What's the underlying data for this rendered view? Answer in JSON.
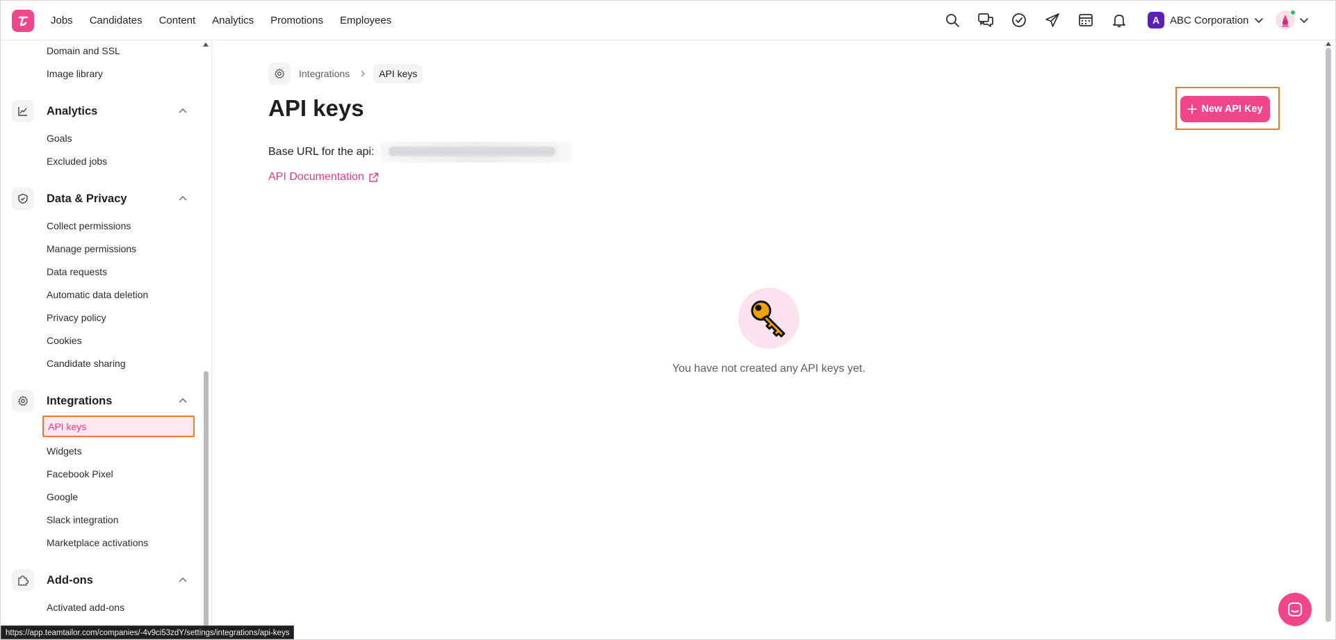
{
  "topnav": {
    "logo_letter": "T",
    "items": [
      "Jobs",
      "Candidates",
      "Content",
      "Analytics",
      "Promotions",
      "Employees"
    ],
    "company_initial": "A",
    "company_name": "ABC Corporation",
    "icons": [
      "search-icon",
      "messages-icon",
      "check-circle-icon",
      "send-icon",
      "calendar-icon",
      "bell-icon"
    ]
  },
  "sidebar": {
    "top_items": [
      "Domain and SSL",
      "Image library"
    ],
    "sections": [
      {
        "label": "Analytics",
        "icon": "chart-icon",
        "items": [
          "Goals",
          "Excluded jobs"
        ]
      },
      {
        "label": "Data & Privacy",
        "icon": "shield-icon",
        "items": [
          "Collect permissions",
          "Manage permissions",
          "Data requests",
          "Automatic data deletion",
          "Privacy policy",
          "Cookies",
          "Candidate sharing"
        ]
      },
      {
        "label": "Integrations",
        "icon": "gear-icon",
        "items": [
          "API keys",
          "Widgets",
          "Facebook Pixel",
          "Google",
          "Slack integration",
          "Marketplace activations"
        ]
      },
      {
        "label": "Add-ons",
        "icon": "puzzle-icon",
        "items": [
          "Activated add-ons"
        ]
      }
    ],
    "active_item": "API keys"
  },
  "breadcrumb": {
    "parent": "Integrations",
    "current": "API keys"
  },
  "main": {
    "title": "API keys",
    "base_url_label": "Base URL for the api:",
    "api_doc_link": "API Documentation",
    "new_button_label": "New API Key",
    "empty_message": "You have not created any API keys yet."
  },
  "status_bar": {
    "url": "https://app.teamtailor.com/companies/-4v9ci53zdY/settings/integrations/api-keys"
  },
  "colors": {
    "brand_pink": "#f1478a",
    "highlight_orange": "#f07a24",
    "active_bg": "#fde7f0"
  }
}
